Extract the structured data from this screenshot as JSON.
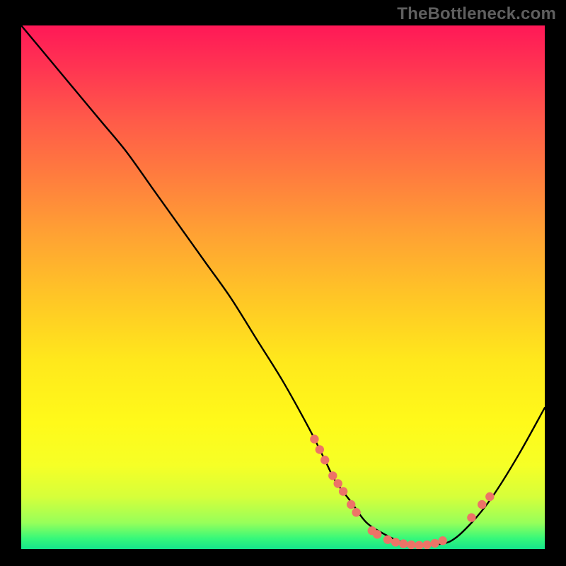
{
  "watermark": "TheBottleneck.com",
  "chart_data": {
    "type": "line",
    "title": "",
    "xlabel": "",
    "ylabel": "",
    "xlim": [
      0,
      100
    ],
    "ylim": [
      0,
      100
    ],
    "grid": false,
    "curve": {
      "name": "bottleneck-curve",
      "x": [
        0,
        5,
        10,
        15,
        20,
        25,
        30,
        35,
        40,
        45,
        50,
        55,
        58,
        60,
        63,
        66,
        70,
        73,
        75,
        78,
        82,
        86,
        90,
        95,
        100
      ],
      "y": [
        100,
        94,
        88,
        82,
        76,
        69,
        62,
        55,
        48,
        40,
        32,
        23,
        17,
        13,
        9,
        5,
        2.5,
        1.2,
        0.8,
        0.8,
        1.5,
        5,
        10,
        18,
        27
      ]
    },
    "dot_clusters": [
      {
        "name": "left-falling-dots",
        "points": [
          {
            "x": 56,
            "y": 21
          },
          {
            "x": 57,
            "y": 19
          },
          {
            "x": 58,
            "y": 17
          },
          {
            "x": 59.5,
            "y": 14
          },
          {
            "x": 60.5,
            "y": 12.5
          },
          {
            "x": 61.5,
            "y": 11
          },
          {
            "x": 63,
            "y": 8.5
          },
          {
            "x": 64,
            "y": 7
          }
        ]
      },
      {
        "name": "valley-dots",
        "points": [
          {
            "x": 67,
            "y": 3.5
          },
          {
            "x": 68,
            "y": 2.8
          },
          {
            "x": 70,
            "y": 1.8
          },
          {
            "x": 71.5,
            "y": 1.3
          },
          {
            "x": 73,
            "y": 1.0
          },
          {
            "x": 74.5,
            "y": 0.8
          },
          {
            "x": 76,
            "y": 0.7
          },
          {
            "x": 77.5,
            "y": 0.8
          },
          {
            "x": 79,
            "y": 1.1
          },
          {
            "x": 80.5,
            "y": 1.6
          }
        ]
      },
      {
        "name": "right-rising-dots",
        "points": [
          {
            "x": 86,
            "y": 6
          },
          {
            "x": 88,
            "y": 8.5
          },
          {
            "x": 89.5,
            "y": 10
          }
        ]
      }
    ],
    "dot_color": "#ed7367",
    "curve_color": "#000000"
  }
}
